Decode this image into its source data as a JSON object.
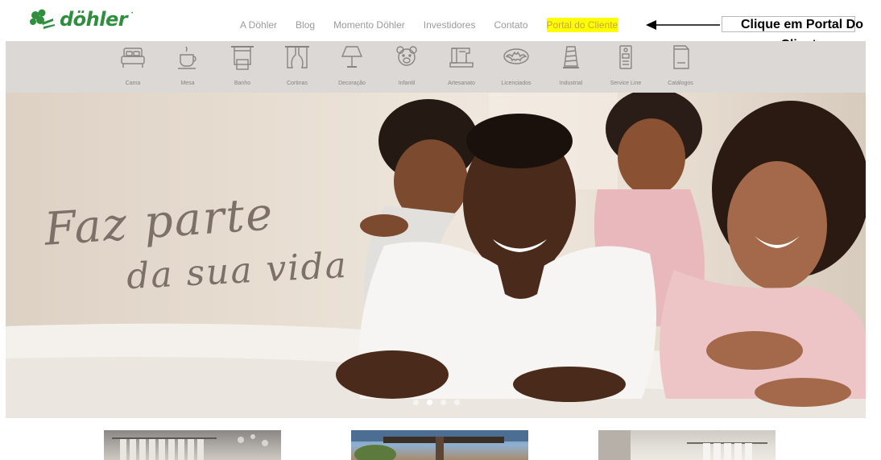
{
  "brand": {
    "name": "döhler",
    "accent": "#2f8f3f"
  },
  "topnav": [
    {
      "label": "A Döhler"
    },
    {
      "label": "Blog"
    },
    {
      "label": "Momento Döhler"
    },
    {
      "label": "Investidores"
    },
    {
      "label": "Contato"
    },
    {
      "label": "Portal do Cliente",
      "highlight": "#ffff00"
    }
  ],
  "annotation": {
    "text": "Clique em Portal Do Cliente"
  },
  "categories": [
    {
      "label": "Cama",
      "icon": "bed-icon"
    },
    {
      "label": "Mesa",
      "icon": "cup-icon"
    },
    {
      "label": "Banho",
      "icon": "towel-icon"
    },
    {
      "label": "Cortinas",
      "icon": "curtain-icon"
    },
    {
      "label": "Decoração",
      "icon": "lamp-icon"
    },
    {
      "label": "Infantil",
      "icon": "teddy-bear-icon"
    },
    {
      "label": "Artesanato",
      "icon": "sewing-machine-icon"
    },
    {
      "label": "Licenciados",
      "icon": "batman-logo-icon"
    },
    {
      "label": "Industrial",
      "icon": "thread-spool-icon"
    },
    {
      "label": "Service Line",
      "icon": "service-tag-icon"
    },
    {
      "label": "Catálogos",
      "icon": "catalog-icon"
    }
  ],
  "hero": {
    "script_line1": "Faz parte",
    "script_line2": "da sua vida",
    "slides": 4,
    "active_slide": 2
  }
}
